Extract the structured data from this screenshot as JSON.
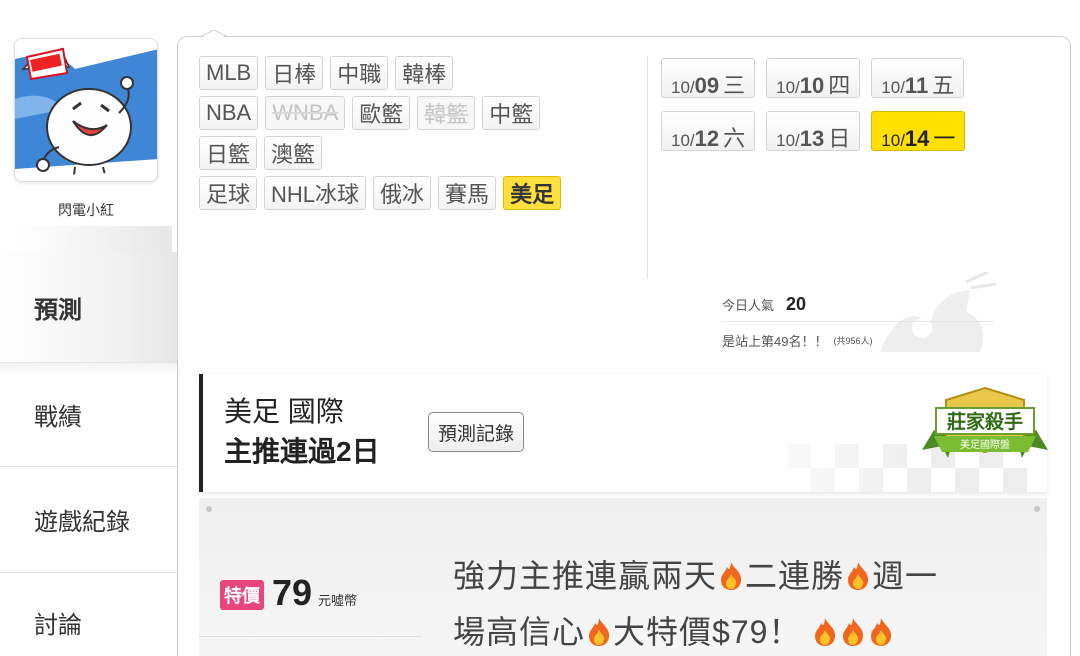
{
  "user": {
    "name": "閃電小紅"
  },
  "nav": {
    "predict": "預測",
    "record": "戰績",
    "game_log": "遊戲紀錄",
    "discuss": "討論"
  },
  "sports": {
    "rows": [
      [
        {
          "label": "MLB",
          "state": "normal"
        },
        {
          "label": "日棒",
          "state": "normal"
        },
        {
          "label": "中職",
          "state": "normal"
        },
        {
          "label": "韓棒",
          "state": "normal"
        }
      ],
      [
        {
          "label": "NBA",
          "state": "normal"
        },
        {
          "label": "WNBA",
          "state": "disabled"
        },
        {
          "label": "歐籃",
          "state": "normal"
        },
        {
          "label": "韓籃",
          "state": "disabled"
        },
        {
          "label": "中籃",
          "state": "normal"
        }
      ],
      [
        {
          "label": "日籃",
          "state": "normal"
        },
        {
          "label": "澳籃",
          "state": "normal"
        }
      ],
      [
        {
          "label": "足球",
          "state": "normal"
        },
        {
          "label": "NHL冰球",
          "state": "normal"
        },
        {
          "label": "俄冰",
          "state": "normal"
        },
        {
          "label": "賽馬",
          "state": "normal"
        },
        {
          "label": "美足",
          "state": "selected"
        }
      ]
    ]
  },
  "dates": {
    "rows": [
      [
        {
          "m": "10/",
          "d": "09",
          "w": "三",
          "selected": false
        },
        {
          "m": "10/",
          "d": "10",
          "w": "四",
          "selected": false
        },
        {
          "m": "10/",
          "d": "11",
          "w": "五",
          "selected": false
        }
      ],
      [
        {
          "m": "10/",
          "d": "12",
          "w": "六",
          "selected": false
        },
        {
          "m": "10/",
          "d": "13",
          "w": "日",
          "selected": false
        },
        {
          "m": "10/",
          "d": "14",
          "w": "一",
          "selected": true
        }
      ]
    ]
  },
  "popularity": {
    "label": "今日人氣",
    "value": "20",
    "rank_text": "是站上第49名！！",
    "total": "(共956人)"
  },
  "title": {
    "line1": "美足 國際",
    "line2": "主推連過2日",
    "record_button": "預測記錄",
    "badge_title": "莊家殺手",
    "badge_sub": "美足國際盤"
  },
  "offer": {
    "tag": "特價",
    "price": "79",
    "unit": "元噓幣",
    "desc_line1_parts": [
      "強力主推連贏兩天",
      "二連勝",
      "週一"
    ],
    "desc_line2_parts": [
      "場高信心",
      "大特價$79！"
    ]
  },
  "colors": {
    "selected_chip": "#ffe03c",
    "price_tag": "#e8457c",
    "badge_green": "#5a9a2a",
    "badge_gold": "#e5c23a"
  }
}
